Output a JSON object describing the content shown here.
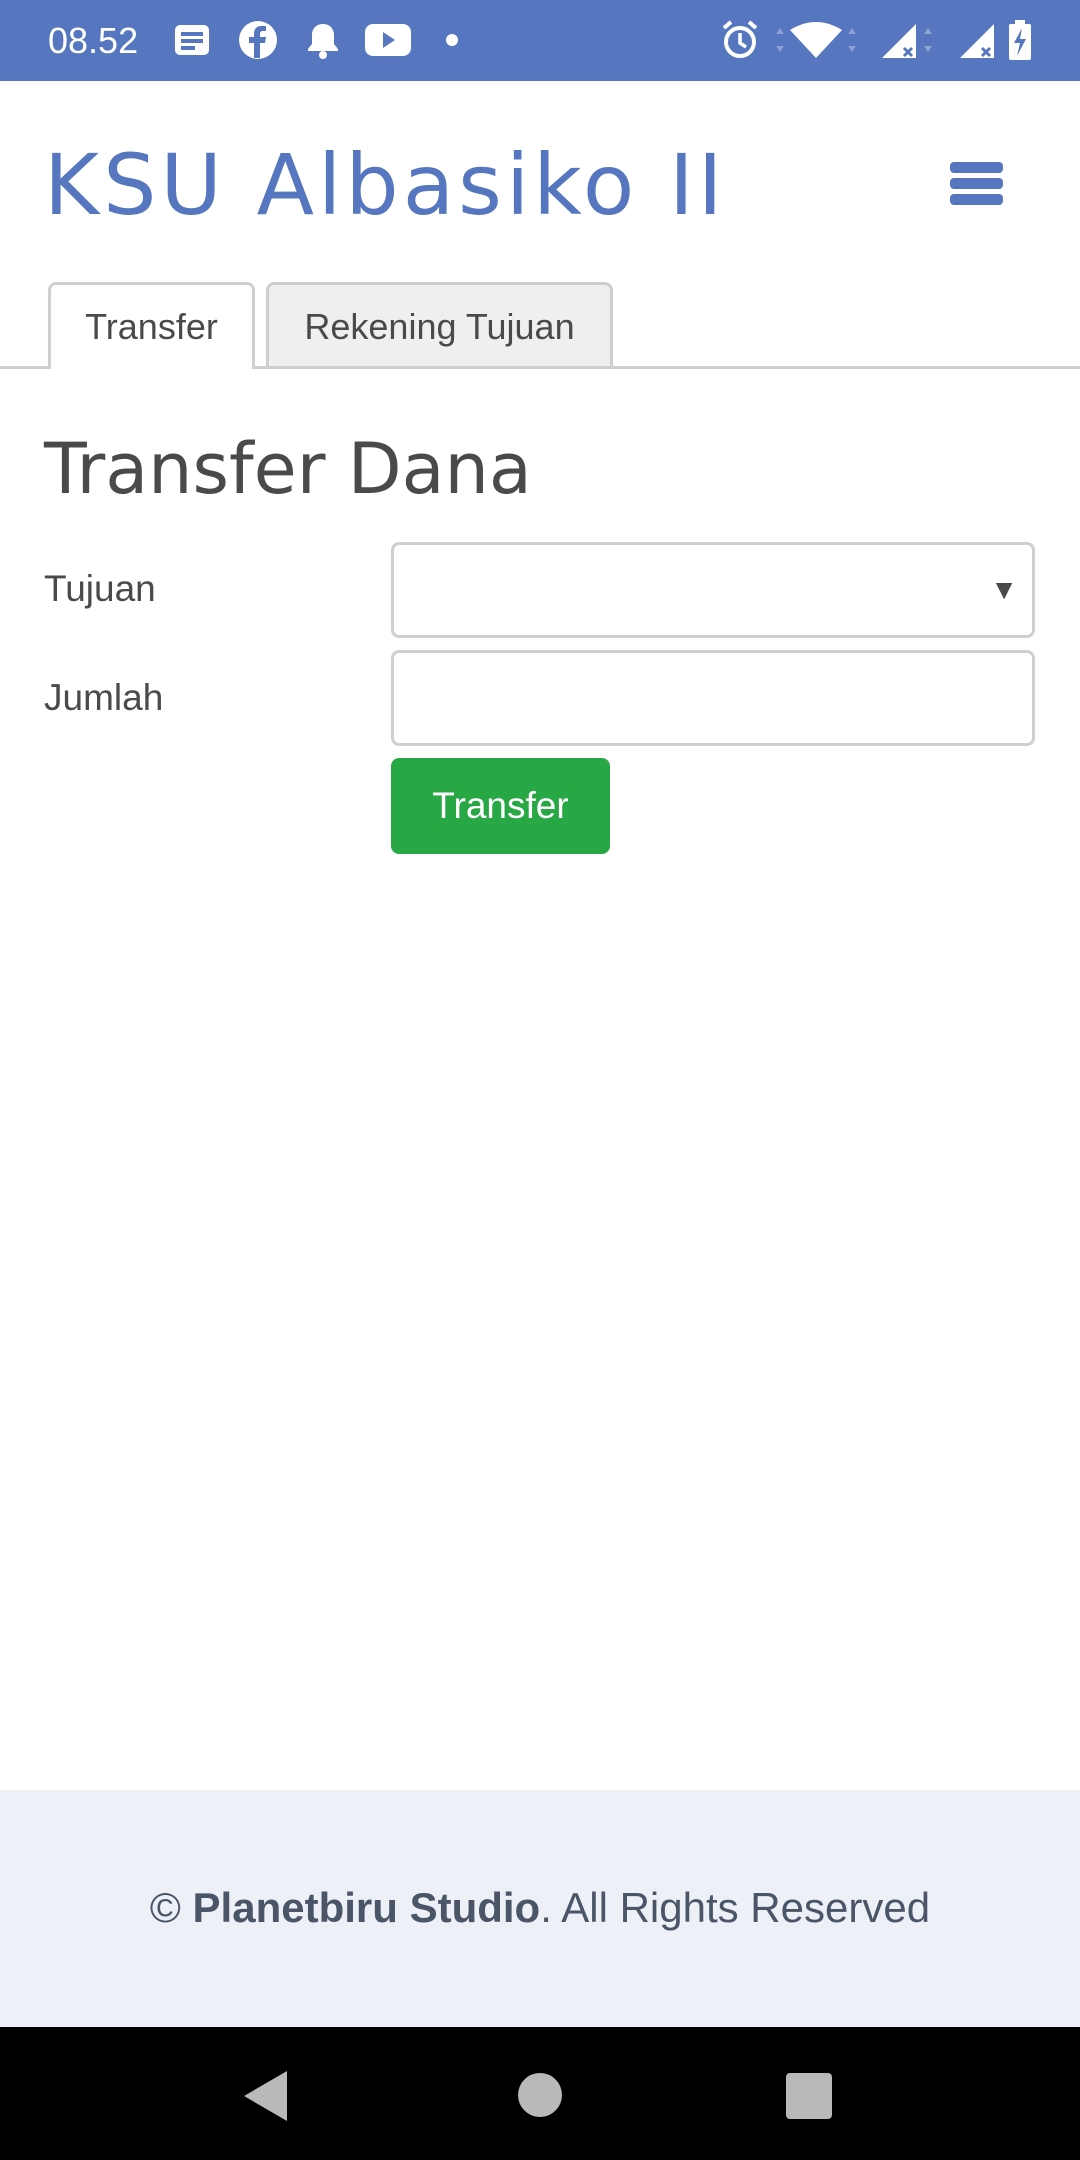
{
  "status_bar": {
    "time": "08.52",
    "left_icons": [
      "message-icon",
      "facebook-icon",
      "bell-icon",
      "youtube-icon",
      "dot-icon"
    ],
    "right_icons": [
      "alarm-icon",
      "wifi-icon",
      "signal-no-sim-icon",
      "signal-no-sim-icon",
      "battery-charging-icon"
    ]
  },
  "header": {
    "brand": "KSU Albasiko II",
    "menu_icon": "hamburger-menu-icon"
  },
  "tabs": [
    {
      "label": "Transfer",
      "active": true
    },
    {
      "label": "Rekening Tujuan",
      "active": false
    }
  ],
  "form": {
    "title": "Transfer Dana",
    "destination_label": "Tujuan",
    "destination_value": "",
    "amount_label": "Jumlah",
    "amount_value": "",
    "submit_label": "Transfer"
  },
  "footer": {
    "symbol": "©",
    "company": "Planetbiru Studio",
    "rights": ". All Rights Reserved"
  },
  "colors": {
    "brand": "#5677bf",
    "status_bar": "#5677bf",
    "button": "#28a745",
    "footer_bg": "#edf0f7"
  }
}
